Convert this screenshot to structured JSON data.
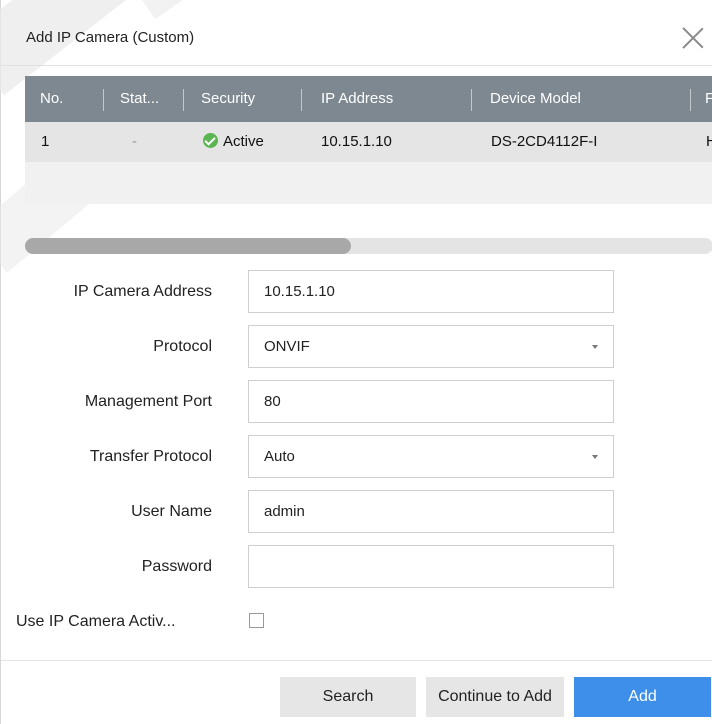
{
  "dialog": {
    "title": "Add IP Camera (Custom)"
  },
  "table": {
    "columns": [
      "No.",
      "Stat...",
      "Security",
      "IP Address",
      "Device Model",
      "F"
    ],
    "rows": [
      {
        "no": "1",
        "status": "-",
        "security": "Active",
        "ip": "10.15.1.10",
        "model": "DS-2CD4112F-I",
        "extra": "H"
      }
    ]
  },
  "form": {
    "ip_label": "IP Camera Address",
    "ip_value": "10.15.1.10",
    "protocol_label": "Protocol",
    "protocol_value": "ONVIF",
    "port_label": "Management Port",
    "port_value": "80",
    "transfer_label": "Transfer Protocol",
    "transfer_value": "Auto",
    "user_label": "User Name",
    "user_value": "admin",
    "password_label": "Password",
    "password_value": "",
    "activation_label": "Use IP Camera Activ...",
    "activation_checked": false
  },
  "buttons": {
    "search": "Search",
    "continue": "Continue to Add",
    "add": "Add"
  },
  "colors": {
    "header_bg": "#7e8891",
    "primary": "#3d8fea",
    "active_check": "#5bb552"
  },
  "icons": {
    "close": "close-icon",
    "check": "check-circle-icon",
    "dropdown": "chevron-down-icon"
  }
}
